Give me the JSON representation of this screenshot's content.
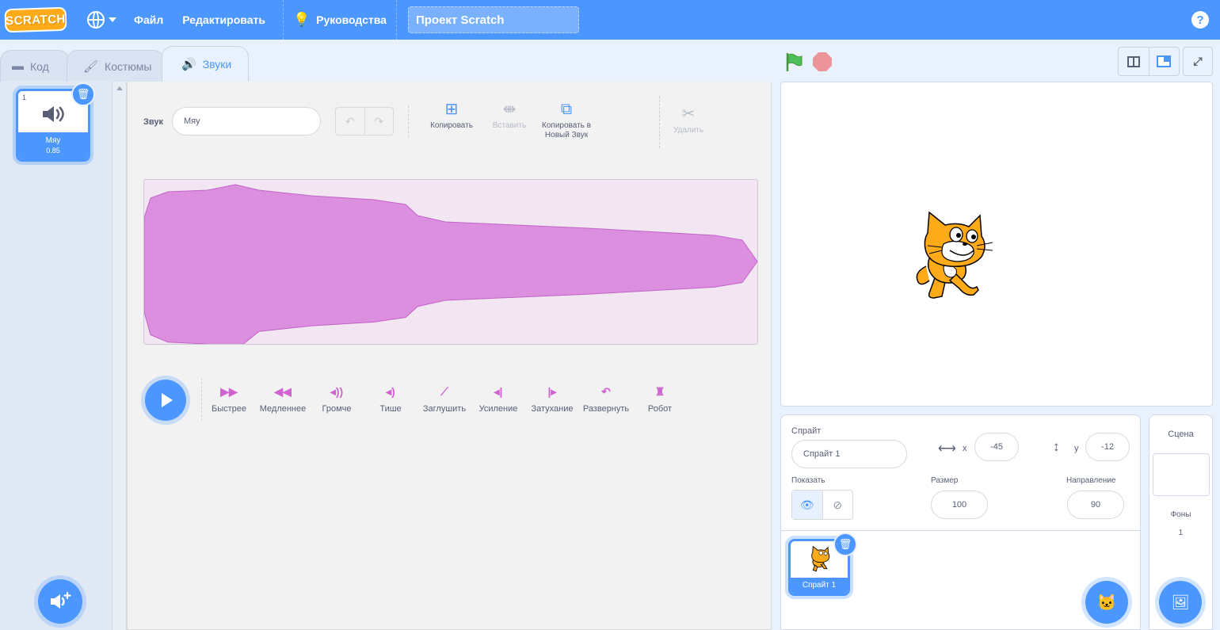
{
  "menu": {
    "logo_text": "SCRATCH",
    "file": "Файл",
    "edit": "Редактировать",
    "tutorials": "Руководства",
    "project_title": "Проект Scratch",
    "help_icon": "?"
  },
  "tabs": [
    {
      "label": "Код",
      "icon": "code-icon"
    },
    {
      "label": "Костюмы",
      "icon": "brush-icon"
    },
    {
      "label": "Звуки",
      "icon": "speaker-icon",
      "active": true
    }
  ],
  "sound_list": {
    "items": [
      {
        "index": "1",
        "name": "Мяу",
        "duration": "0.85",
        "selected": true
      }
    ]
  },
  "editor": {
    "sound_label": "Звук",
    "sound_name": "Мяу",
    "tools": {
      "copy": "Копировать",
      "paste": "Вставить",
      "copy_new": "Копировать в Новый Звук",
      "delete": "Удалить"
    },
    "effects": [
      {
        "label": "Быстрее",
        "icon": "faster-icon"
      },
      {
        "label": "Медленнее",
        "icon": "slower-icon"
      },
      {
        "label": "Громче",
        "icon": "louder-icon"
      },
      {
        "label": "Тише",
        "icon": "softer-icon"
      },
      {
        "label": "Заглушить",
        "icon": "mute-icon"
      },
      {
        "label": "Усиление",
        "icon": "fade-in-icon"
      },
      {
        "label": "Затухание",
        "icon": "fade-out-icon"
      },
      {
        "label": "Развернуть",
        "icon": "reverse-icon"
      },
      {
        "label": "Робот",
        "icon": "robot-icon"
      }
    ],
    "waveform_color": "#dd8fdf"
  },
  "sprite_info": {
    "sprite_label": "Спрайт",
    "sprite_name": "Спрайт 1",
    "x_label": "x",
    "x_value": "-45",
    "y_label": "y",
    "y_value": "-12",
    "show_label": "Показать",
    "size_label": "Размер",
    "size_value": "100",
    "direction_label": "Направление",
    "direction_value": "90"
  },
  "sprites": [
    {
      "name": "Спрайт 1",
      "selected": true
    }
  ],
  "stage_pane": {
    "title": "Сцена",
    "backdrops_label": "Фоны",
    "backdrops_count": "1"
  },
  "colors": {
    "accent": "#4c97ff",
    "menubar": "#4c97ff",
    "sound_effect": "#cf63cf",
    "stop": "#ec5959",
    "flag": "#4cbf56"
  }
}
